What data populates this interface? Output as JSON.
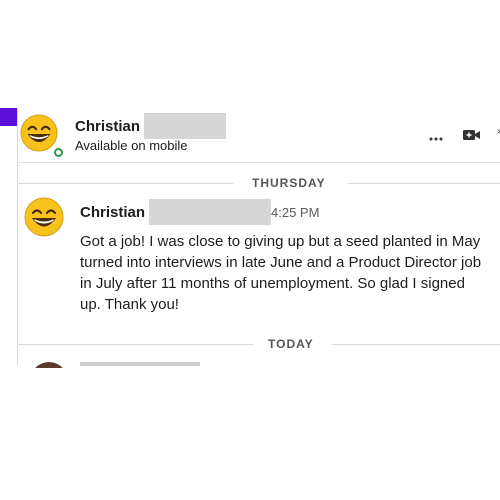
{
  "header": {
    "name": "Christian",
    "status": "Available on mobile",
    "more_icon": "more-horizontal-icon",
    "video_icon": "video-call-icon"
  },
  "dividers": {
    "first": "THURSDAY",
    "second": "TODAY"
  },
  "message": {
    "sender": "Christian",
    "time": "4:25 PM",
    "text": "Got a job! I was close to giving up but a seed planted in May turned into interviews in late June and a Product Director job in July after 11 months of unemployment. So glad I signed up. Thank you!"
  },
  "colors": {
    "accent": "#5b0fd8",
    "presence": "#2f9a4e",
    "redaction": "#d6d6d6"
  }
}
